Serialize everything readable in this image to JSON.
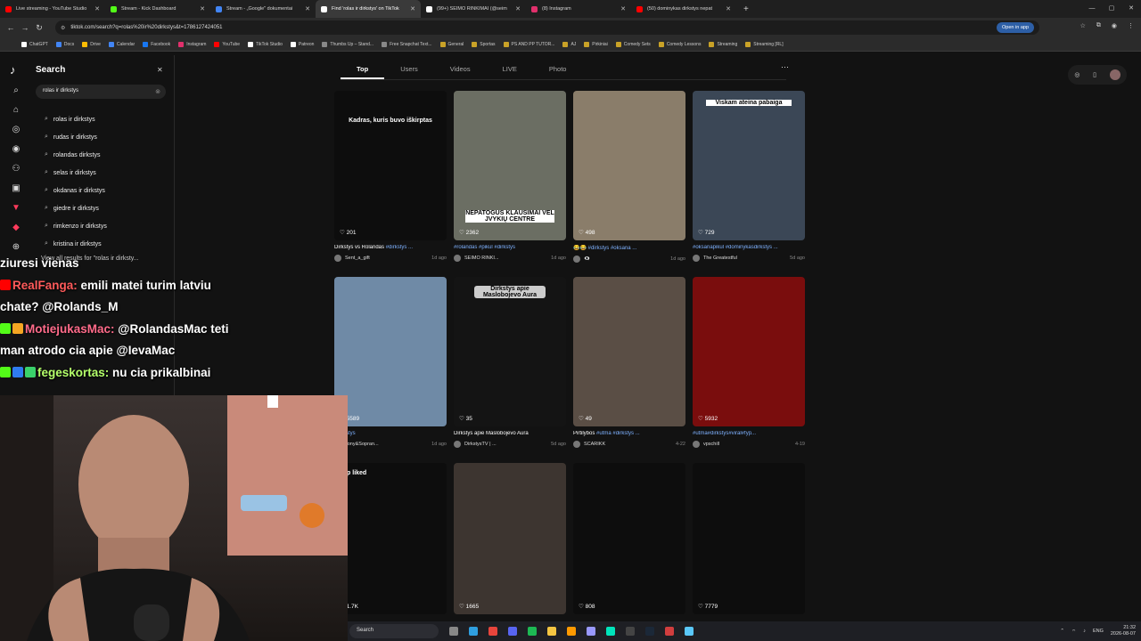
{
  "browser": {
    "tabs": [
      {
        "title": "Live streaming - YouTube Studio",
        "color": "#ff0000"
      },
      {
        "title": "Stream - Kick Dashboard",
        "color": "#53fc18"
      },
      {
        "title": "Stream - „Google\" dokumentai",
        "color": "#4285f4"
      },
      {
        "title": "Find 'rolas ir dirkstys' on TikTok",
        "color": "#ffffff",
        "active": true
      },
      {
        "title": "(99+) SEIMO RINKIMAI (@seim",
        "color": "#ffffff"
      },
      {
        "title": "(8) Instagram",
        "color": "#e1306c"
      },
      {
        "title": "(50) dominykas dirkstys nepat",
        "color": "#ff0000"
      }
    ],
    "url": "tiktok.com/search?q=rolas%20ir%20dirkstys&t=1786127424051",
    "open_in_app": "Open in app",
    "bookmarks": [
      {
        "label": "ChatGPT",
        "color": "#ffffff"
      },
      {
        "label": "Docs",
        "color": "#4285f4"
      },
      {
        "label": "Drive",
        "color": "#fbbc04"
      },
      {
        "label": "Calendar",
        "color": "#4285f4"
      },
      {
        "label": "Facebook",
        "color": "#1877f2"
      },
      {
        "label": "Instagram",
        "color": "#e1306c"
      },
      {
        "label": "YouTube",
        "color": "#ff0000"
      },
      {
        "label": "TikTok Studio",
        "color": "#ffffff"
      },
      {
        "label": "Patreon",
        "color": "#ffffff"
      },
      {
        "label": "Thumbs Up – Stand...",
        "color": "#888888"
      },
      {
        "label": "Free Snapchat Text...",
        "color": "#888888"
      },
      {
        "label": "General",
        "color": "#c9a227"
      },
      {
        "label": "Sportas",
        "color": "#c9a227"
      },
      {
        "label": "PS AND PP TUTOR...",
        "color": "#c9a227"
      },
      {
        "label": "AJ",
        "color": "#c9a227"
      },
      {
        "label": "Pirkiniai",
        "color": "#c9a227"
      },
      {
        "label": "Comedy Sets",
        "color": "#c9a227"
      },
      {
        "label": "Comedy Lessons",
        "color": "#c9a227"
      },
      {
        "label": "Streaming",
        "color": "#c9a227"
      },
      {
        "label": "Streaming [RL]",
        "color": "#c9a227"
      }
    ]
  },
  "sidebar": {
    "title": "Search",
    "query": "rolas ir dirkstys",
    "suggestions": [
      "rolas ir dirkstys",
      "rudas ir dirkstys",
      "rolandas dirkstys",
      "selas ir dirkstys",
      "okdanas ir dirkstys",
      "giedre ir dirkstys",
      "rimkenzo ir dirkstys",
      "kristina ir dirkstys"
    ],
    "view_all": "View all results for \"rolas ir dirksty..."
  },
  "results": {
    "tabs": [
      "Top",
      "Users",
      "Videos",
      "LIVE",
      "Photo"
    ],
    "cards": [
      {
        "likes": "201",
        "caption": "Dirkstys vs Rolandas ",
        "tags": "#dirkstys ...",
        "author": "Sent_a_gift",
        "date": "1d ago",
        "overlay": "Kadras, kuris buvo iškirptas",
        "bg": "#0d0d0d"
      },
      {
        "likes": "2362",
        "caption": "",
        "tags": "#rolandas #pikul #dirkstys",
        "author": "SEIMO RINKI...",
        "date": "1d ago",
        "overlay": "NEPATOGUS KLAUSIMAI VEL JVYKIŲ CENTRE",
        "bg": "#6b6e63"
      },
      {
        "likes": "498",
        "caption": "😂😂 ",
        "tags": "#dirkstys #oksana ...",
        "author": "👁‍🗨",
        "date": "1d ago",
        "overlay": "",
        "bg": "#8a7d6a"
      },
      {
        "likes": "729",
        "caption": "",
        "tags": "#oksanapikul #dominykasdirkstys ...",
        "author": "The Greatestful",
        "date": "5d ago",
        "overlay": "Viskam ateina pabaiga",
        "bg": "#3b4756"
      },
      {
        "likes": "5589",
        "caption": "",
        "tags": "#dirkstys",
        "author": "Tony&Sopran...",
        "date": "1d ago",
        "overlay": "",
        "bg": "#6f8aa6"
      },
      {
        "likes": "35",
        "caption": "Dirkstys apie Maslobojevo Aura",
        "tags": "",
        "author": "DirkstysTV | ...",
        "date": "5d ago",
        "overlay": "Dirkstys apie Maslobojevo Aura",
        "bg": "#141414"
      },
      {
        "likes": "49",
        "caption": "Pirtilybos ",
        "tags": "#utma #dirkstys ...",
        "author": "SCARIKK",
        "date": "4-22",
        "overlay": "",
        "bg": "#5a4e45"
      },
      {
        "likes": "5932",
        "caption": "",
        "tags": "#utma#dirkstys#viral#fyp...",
        "author": "vpschill",
        "date": "4-19",
        "overlay": "",
        "bg": "#7a0d0d"
      },
      {
        "likes": "1.7K",
        "caption": "",
        "tags": "",
        "author": "",
        "date": "",
        "overlay": "Top liked",
        "bg": "#0d0d0d"
      },
      {
        "likes": "1665",
        "caption": "",
        "tags": "",
        "author": "",
        "date": "",
        "overlay": "",
        "bg": "#3d3530"
      },
      {
        "likes": "808",
        "caption": "",
        "tags": "",
        "author": "",
        "date": "",
        "overlay": "",
        "bg": "#0d0d0d"
      },
      {
        "likes": "7779",
        "caption": "",
        "tags": "",
        "author": "",
        "date": "",
        "overlay": "",
        "bg": "#0d0d0d"
      }
    ]
  },
  "chat": {
    "lines": [
      {
        "user": "",
        "text": "ziuresi vienas",
        "badge_color": ""
      },
      {
        "user": "RealFanga:",
        "text": " emili matei turim latviu",
        "badge_color": "#ff0000"
      },
      {
        "user": "",
        "text": "chate? @Rolands_M",
        "badge_color": ""
      },
      {
        "user": "MotiejukasMac:",
        "text": " @RolandasMac teti",
        "badge_color": "#53fc18"
      },
      {
        "user": "",
        "text": "man atrodo cia apie @IevaMac",
        "badge_color": ""
      },
      {
        "user": "fegeskortas:",
        "text": " nu cia prikalbinai",
        "badge_color": "#53fc18"
      }
    ]
  },
  "taskbar": {
    "search": "Search",
    "lang": "ENG",
    "time": "21:32",
    "date": "2026-08-07"
  }
}
